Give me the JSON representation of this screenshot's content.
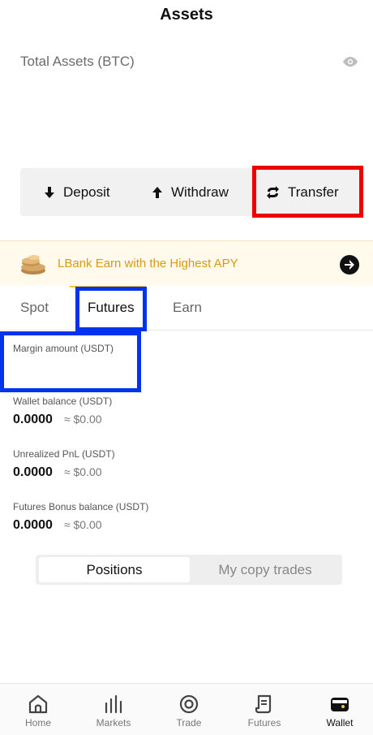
{
  "header": {
    "title": "Assets"
  },
  "total": {
    "label": "Total Assets (BTC)"
  },
  "actions": {
    "deposit": "Deposit",
    "withdraw": "Withdraw",
    "transfer": "Transfer"
  },
  "banner": {
    "text": "LBank Earn with the Highest APY"
  },
  "tabs": {
    "spot": "Spot",
    "futures": "Futures",
    "earn": "Earn",
    "active": "Futures"
  },
  "balances": {
    "margin": {
      "label": "Margin amount (USDT)"
    },
    "wallet": {
      "label": "Wallet balance (USDT)",
      "value": "0.0000",
      "approx": "≈ $0.00"
    },
    "unrealized": {
      "label": "Unrealized PnL (USDT)",
      "value": "0.0000",
      "approx": "≈ $0.00"
    },
    "bonus": {
      "label": "Futures Bonus balance (USDT)",
      "value": "0.0000",
      "approx": "≈ $0.00"
    }
  },
  "segment": {
    "positions": "Positions",
    "copy": "My copy trades",
    "active": "Positions"
  },
  "nav": {
    "items": [
      {
        "label": "Home",
        "icon": "home-icon"
      },
      {
        "label": "Markets",
        "icon": "markets-icon"
      },
      {
        "label": "Trade",
        "icon": "trade-icon"
      },
      {
        "label": "Futures",
        "icon": "futures-icon"
      },
      {
        "label": "Wallet",
        "icon": "wallet-icon"
      }
    ],
    "active": "Wallet"
  },
  "colors": {
    "highlight_red": "#ee0000",
    "highlight_blue": "#0033ee",
    "banner_text": "#d99a0e",
    "tab_indicator": "#f4c542"
  }
}
